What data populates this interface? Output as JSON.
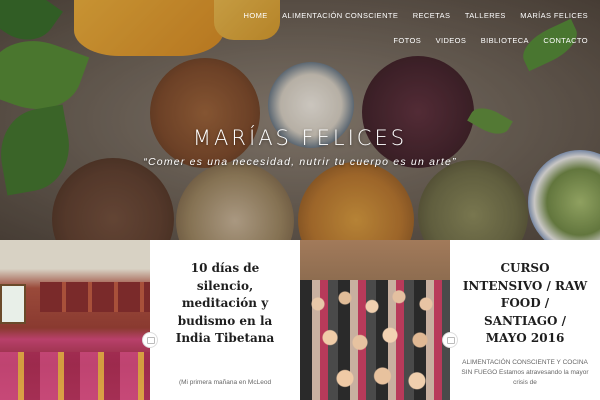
{
  "nav": {
    "items": [
      "HOME",
      "ALIMENTACIÓN CONSCIENTE",
      "RECETAS",
      "TALLERES",
      "MARÍAS FELICES",
      "FOTOS",
      "VIDEOS",
      "BIBLIOTECA",
      "CONTACTO"
    ]
  },
  "site": {
    "title": "MARÍAS FELICES",
    "tagline": "“Comer es una necesidad, nutrir tu cuerpo es un arte”"
  },
  "posts": [
    {
      "title": "10 días de silencio, meditación y budismo en la India Tibetana",
      "excerpt": "(Mi primera mañana en McLeod"
    },
    {
      "title": "CURSO INTENSIVO / RAW FOOD / SANTIAGO / MAYO 2016",
      "excerpt": "ALIMENTACIÓN CONSCIENTE Y COCINA SIN FUEGO Estamos atravesando la mayor crisis de"
    }
  ],
  "colors": {
    "nav_text": "#ffffff",
    "card_bg": "#ffffff",
    "title_text": "#1e1e1e"
  }
}
